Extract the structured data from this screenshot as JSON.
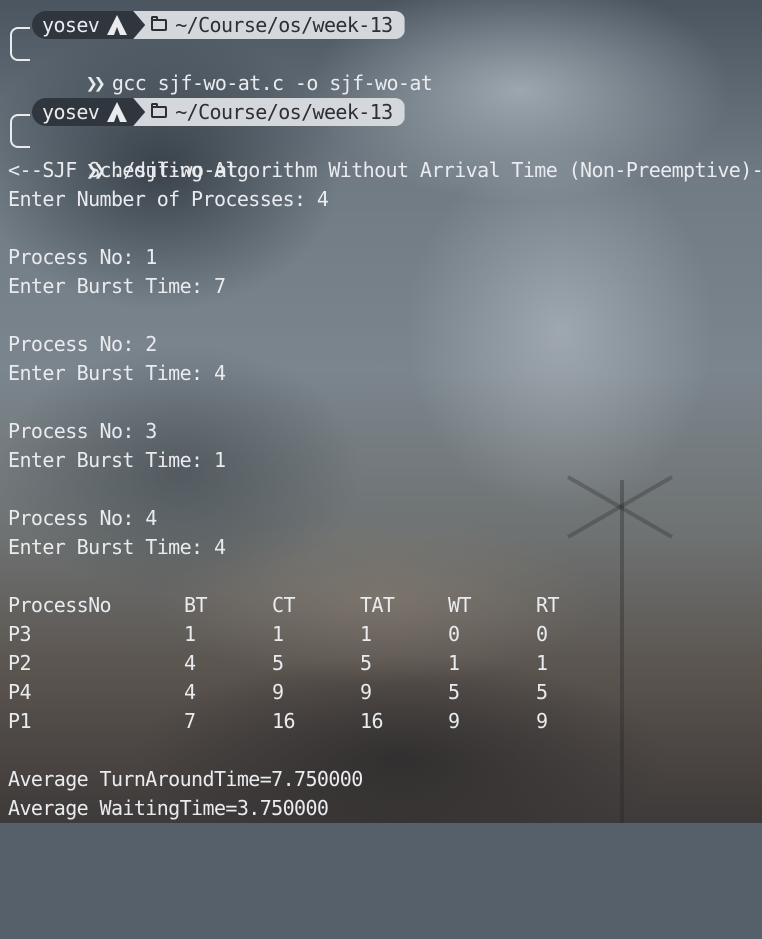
{
  "prompts": [
    {
      "user": "yosev",
      "os_icon": "arch-linux-icon",
      "path": "~/Course/os/week-13",
      "command": "gcc sjf-wo-at.c -o sjf-wo-at"
    },
    {
      "user": "yosev",
      "os_icon": "arch-linux-icon",
      "path": "~/Course/os/week-13",
      "command": "./sjf-wo-at"
    }
  ],
  "output": {
    "title": "<--SJF Scheduling Algorithm Without Arrival Time (Non-Preemptive)-->",
    "num_processes_prompt": "Enter Number of Processes: 4",
    "processes": [
      {
        "process_no": "Process No: 1",
        "burst": "Enter Burst Time: 7"
      },
      {
        "process_no": "Process No: 2",
        "burst": "Enter Burst Time: 4"
      },
      {
        "process_no": "Process No: 3",
        "burst": "Enter Burst Time: 1"
      },
      {
        "process_no": "Process No: 4",
        "burst": "Enter Burst Time: 4"
      }
    ],
    "table": {
      "headers": [
        "ProcessNo",
        "BT",
        "CT",
        "TAT",
        "WT",
        "RT"
      ],
      "rows": [
        [
          "P3",
          "1",
          "1",
          "1",
          "0",
          "0"
        ],
        [
          "P2",
          "4",
          "5",
          "5",
          "1",
          "1"
        ],
        [
          "P4",
          "4",
          "9",
          "9",
          "5",
          "5"
        ],
        [
          "P1",
          "7",
          "16",
          "16",
          "9",
          "9"
        ]
      ]
    },
    "avg_tat": "Average TurnAroundTime=7.750000",
    "avg_wt": "Average WaitingTime=3.750000"
  },
  "colors": {
    "text": "#e9ebee",
    "pill_dark": "#2f363d",
    "pill_light": "#d4d8dc"
  }
}
